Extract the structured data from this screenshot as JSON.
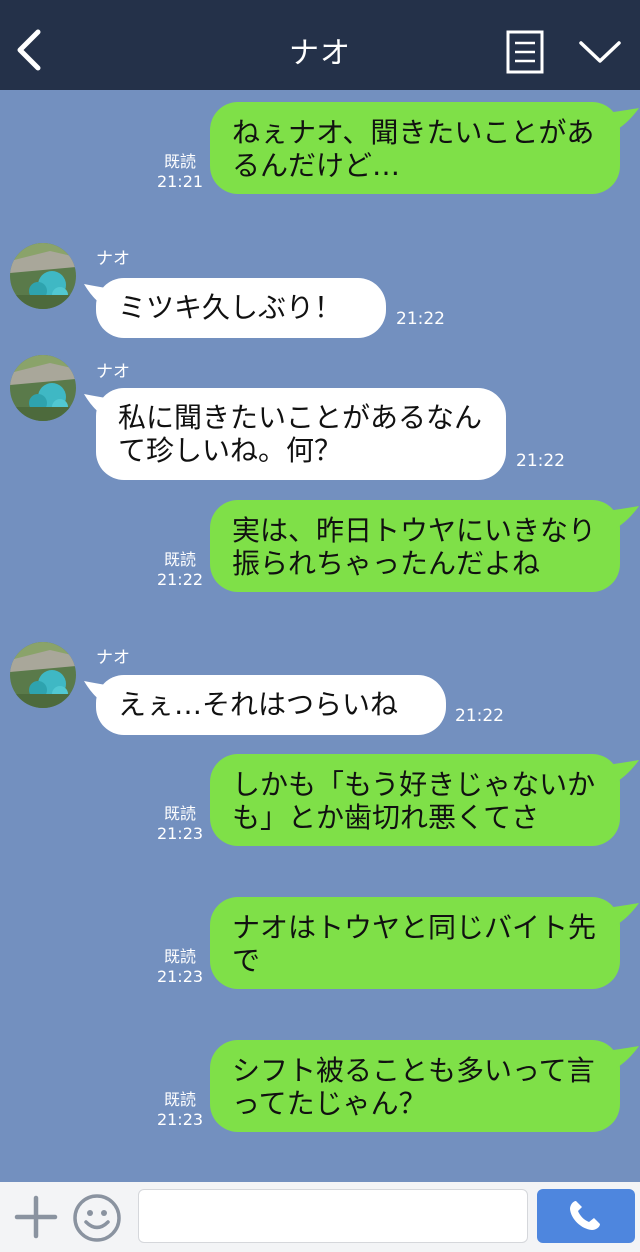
{
  "header": {
    "title": "ナオ"
  },
  "messages": [
    {
      "dir": "out",
      "text": "ねぇナオ、聞きたいことがあるんだけど…",
      "read": "既読",
      "time": "21:21"
    },
    {
      "dir": "in",
      "sender": "ナオ",
      "text": "ミツキ久しぶり！",
      "time": "21:22"
    },
    {
      "dir": "in",
      "sender": "ナオ",
      "text": "私に聞きたいことがあるなんて珍しいね。何？",
      "time": "21:22"
    },
    {
      "dir": "out",
      "text": "実は、昨日トウヤにいきなり振られちゃったんだよね",
      "read": "既読",
      "time": "21:22"
    },
    {
      "dir": "in",
      "sender": "ナオ",
      "text": "えぇ…それはつらいね",
      "time": "21:22"
    },
    {
      "dir": "out",
      "text": "しかも「もう好きじゃないかも」とか歯切れ悪くてさ",
      "read": "既読",
      "time": "21:23"
    },
    {
      "dir": "out",
      "text": "ナオはトウヤと同じバイト先で",
      "read": "既読",
      "time": "21:23"
    },
    {
      "dir": "out",
      "text": "シフト被ることも多いって言ってたじゃん？",
      "read": "既読",
      "time": "21:23"
    }
  ],
  "footer": {
    "input_value": "",
    "input_placeholder": ""
  },
  "colors": {
    "header_bg": "#243149",
    "chat_bg": "#7390bf",
    "outgoing_bubble": "#7fe048",
    "incoming_bubble": "#ffffff",
    "send_button": "#4e86de"
  },
  "icons": [
    "back-arrow-icon",
    "menu-list-icon",
    "chevron-down-icon",
    "plus-icon",
    "smile-icon",
    "phone-icon"
  ]
}
